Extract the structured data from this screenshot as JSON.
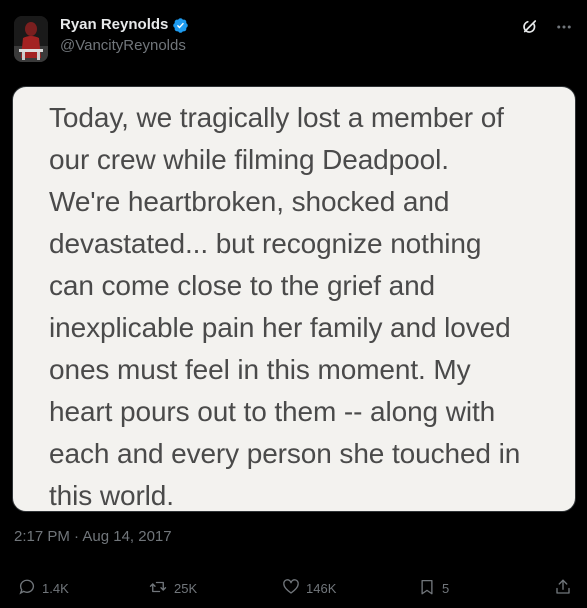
{
  "author": {
    "display_name": "Ryan Reynolds",
    "handle": "@VancityReynolds",
    "verified": true
  },
  "header_icons": [
    "grok-icon",
    "more-icon"
  ],
  "image_text": "Today, we tragically lost a member of\nour crew while filming Deadpool.\nWe're heartbroken, shocked and\ndevastated... but recognize nothing\ncan come close to the grief and\ninexplicable pain her family and loved\nones must feel in this moment. My\nheart pours out to them -- along with\neach and every person she touched in\nthis world.",
  "timestamp": "2:17 PM · Aug 14, 2017",
  "actions": {
    "replies": "1.4K",
    "retweets": "25K",
    "likes": "146K",
    "bookmarks": "5"
  },
  "colors": {
    "background": "#000000",
    "text_primary": "#e7e9ea",
    "text_secondary": "#71767b",
    "verified_blue": "#1d9bf0",
    "card_background": "#f3f2ef",
    "card_text": "#4a4a4a"
  }
}
